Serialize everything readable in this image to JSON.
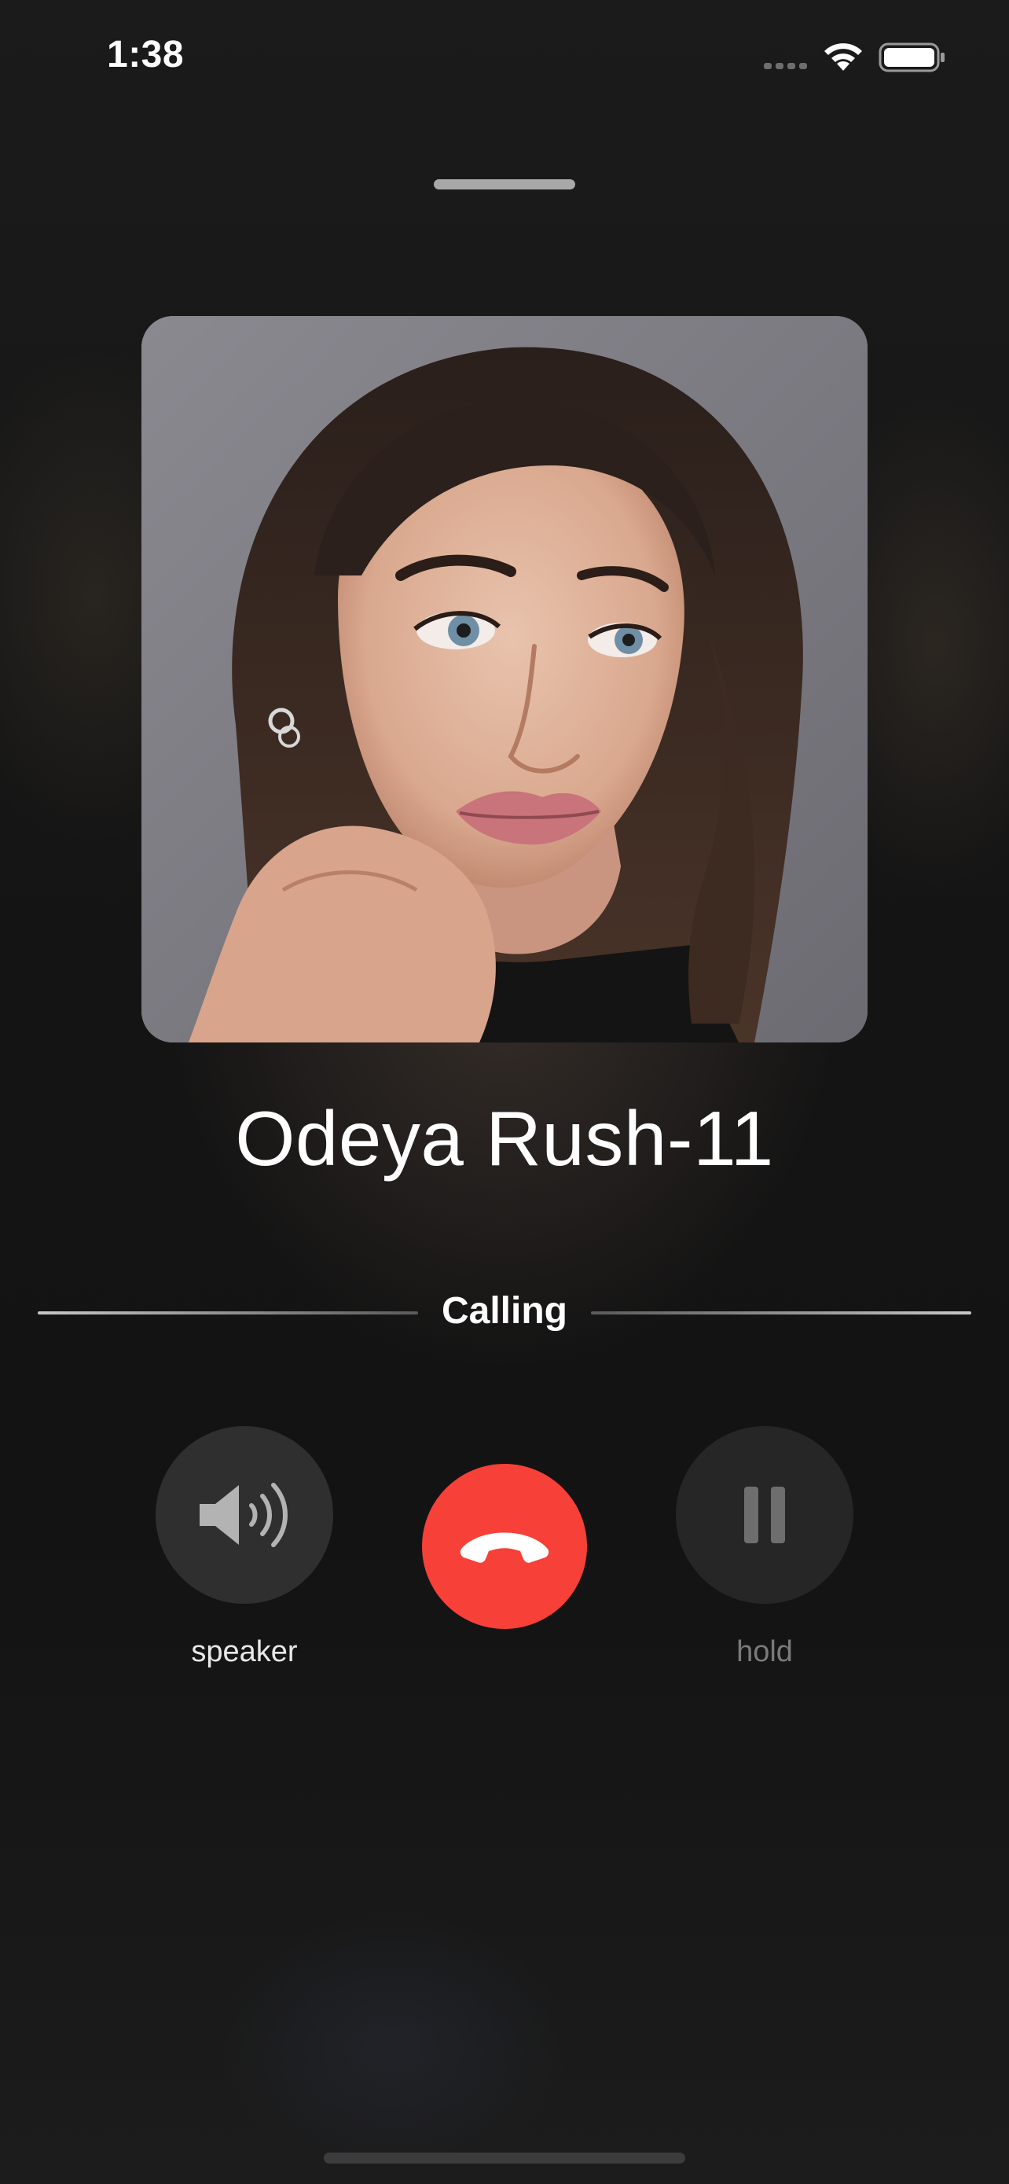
{
  "status_bar": {
    "time": "1:38"
  },
  "contact": {
    "name": "Odeya Rush-11"
  },
  "call": {
    "status": "Calling"
  },
  "controls": {
    "speaker_label": "speaker",
    "hold_label": "hold"
  },
  "icons": {
    "signal": "cellular-signal-icon",
    "wifi": "wifi-icon",
    "battery": "battery-icon",
    "speaker": "speaker-wave-icon",
    "end_call": "phone-hangup-icon",
    "hold": "pause-icon"
  },
  "colors": {
    "end_call": "#f74038",
    "control_bg": "#2f2f2f",
    "hold_disabled_text": "#7a7a7a"
  }
}
